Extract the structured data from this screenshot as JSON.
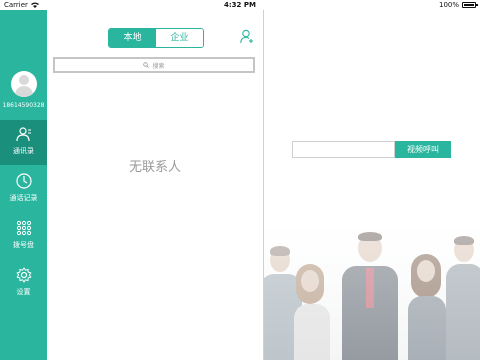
{
  "status_bar": {
    "carrier": "Carrier",
    "time": "4:32 PM",
    "battery": "100%"
  },
  "sidebar": {
    "phone_number": "18614590328",
    "items": [
      {
        "label": "通讯录",
        "icon": "contacts-icon",
        "active": true
      },
      {
        "label": "通话记录",
        "icon": "clock-icon",
        "active": false
      },
      {
        "label": "拨号盘",
        "icon": "dialpad-icon",
        "active": false
      },
      {
        "label": "设置",
        "icon": "gear-icon",
        "active": false
      }
    ]
  },
  "contacts": {
    "tabs": [
      "本地",
      "企业"
    ],
    "search_placeholder": "搜索",
    "empty_text": "无联系人"
  },
  "video_call": {
    "input_value": "",
    "button_label": "视频呼叫"
  },
  "colors": {
    "accent": "#2ab59f",
    "accent_dark": "#1a8f7c"
  }
}
